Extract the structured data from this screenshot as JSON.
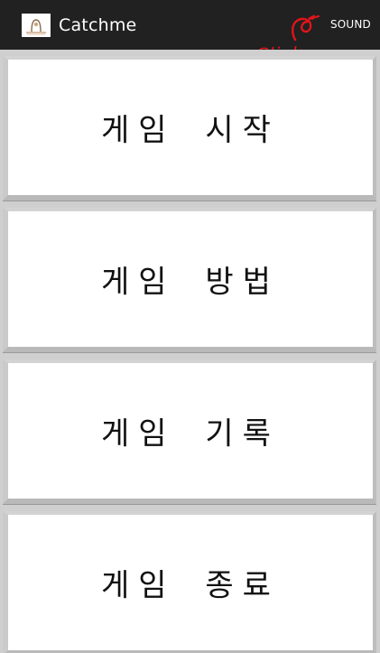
{
  "action_bar": {
    "title": "Catchme",
    "sound_label": "SOUND",
    "app_icon": "catchme-app-icon",
    "background": "#212121"
  },
  "annotation": {
    "text": "Click",
    "color": "#e1141a"
  },
  "menu": {
    "items": [
      {
        "label": "게임 시작"
      },
      {
        "label": "게임 방법"
      },
      {
        "label": "게임 기록"
      },
      {
        "label": "게임 종료"
      }
    ]
  }
}
